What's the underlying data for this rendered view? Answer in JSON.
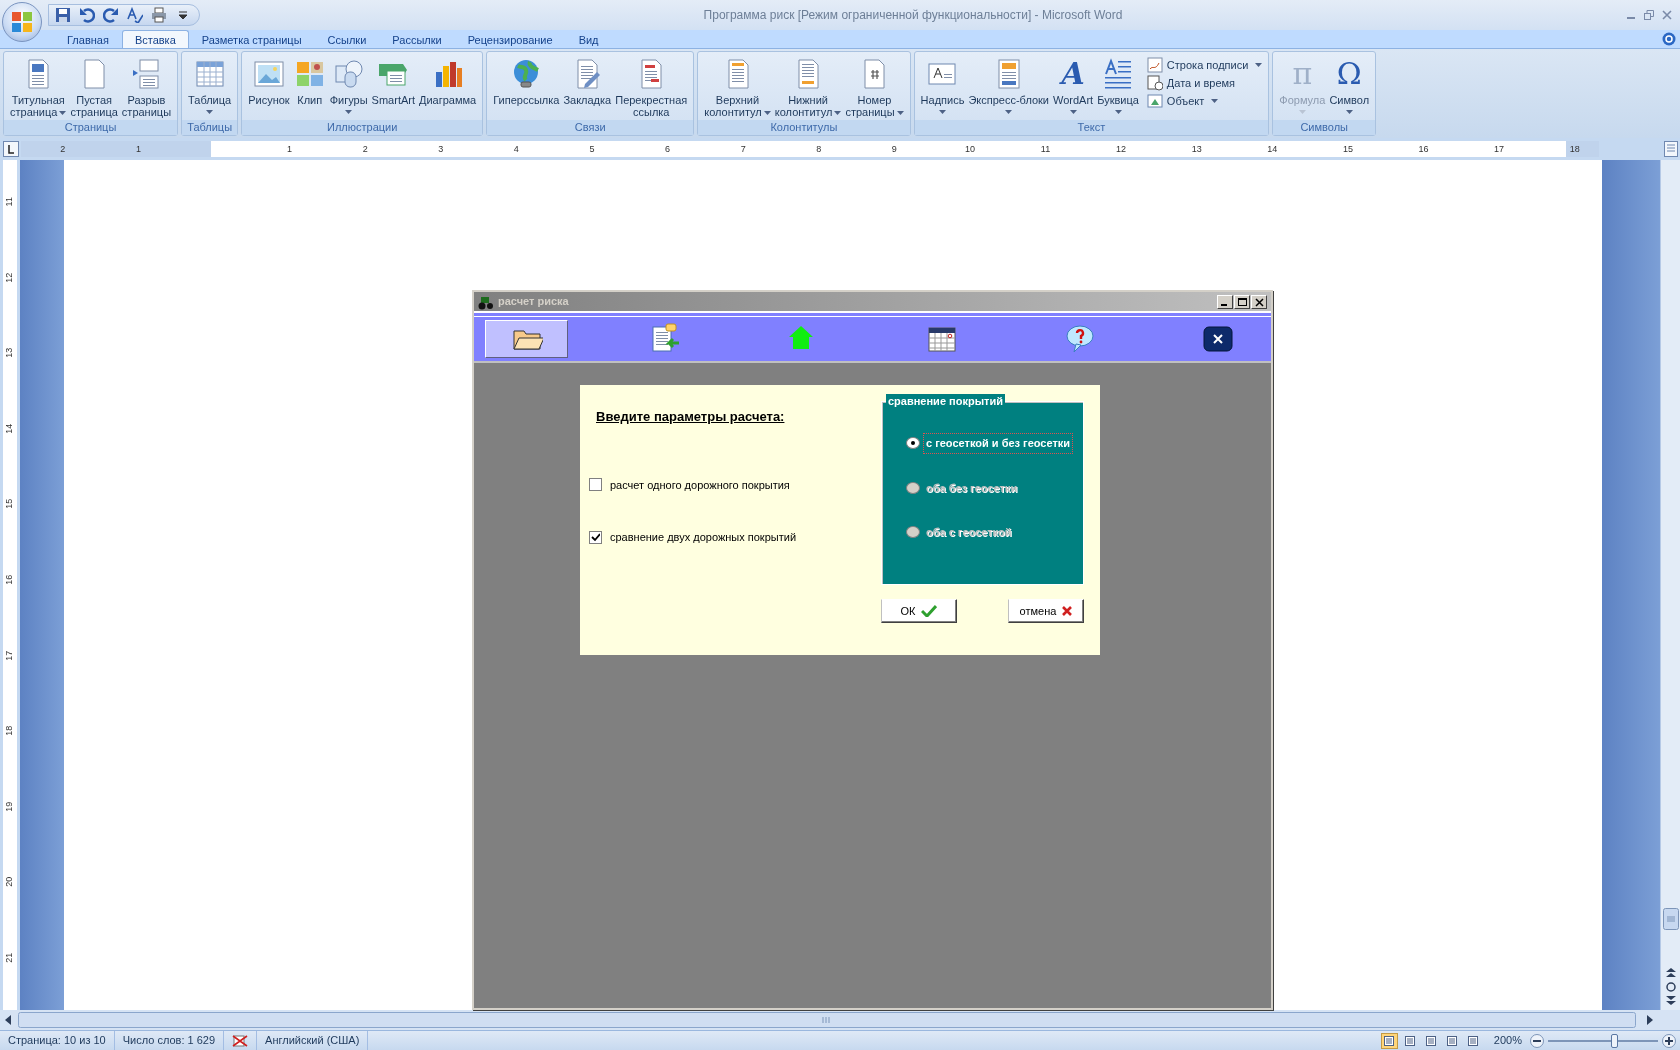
{
  "window": {
    "title": "Программа риск [Режим ограниченной функциональности] - Microsoft Word"
  },
  "tabs": [
    {
      "label": "Главная",
      "selected": false
    },
    {
      "label": "Вставка",
      "selected": true
    },
    {
      "label": "Разметка страницы",
      "selected": false
    },
    {
      "label": "Ссылки",
      "selected": false
    },
    {
      "label": "Рассылки",
      "selected": false
    },
    {
      "label": "Рецензирование",
      "selected": false
    },
    {
      "label": "Вид",
      "selected": false
    }
  ],
  "ribbon_groups": [
    {
      "label": "Страницы",
      "buttons": [
        {
          "lines": [
            "Титульная",
            "страница"
          ],
          "dropdown": true
        },
        {
          "lines": [
            "Пустая",
            "страница"
          ],
          "dropdown": false
        },
        {
          "lines": [
            "Разрыв",
            "страницы"
          ],
          "dropdown": false
        }
      ]
    },
    {
      "label": "Таблицы",
      "buttons": [
        {
          "lines": [
            "Таблица"
          ],
          "dropdown": true
        }
      ]
    },
    {
      "label": "Иллюстрации",
      "buttons": [
        {
          "lines": [
            "Рисунок"
          ],
          "dropdown": false
        },
        {
          "lines": [
            "Клип"
          ],
          "dropdown": false
        },
        {
          "lines": [
            "Фигуры"
          ],
          "dropdown": true
        },
        {
          "lines": [
            "SmartArt"
          ],
          "dropdown": false
        },
        {
          "lines": [
            "Диаграмма"
          ],
          "dropdown": false
        }
      ]
    },
    {
      "label": "Связи",
      "buttons": [
        {
          "lines": [
            "Гиперссылка"
          ],
          "dropdown": false
        },
        {
          "lines": [
            "Закладка"
          ],
          "dropdown": false
        },
        {
          "lines": [
            "Перекрестная",
            "ссылка"
          ],
          "dropdown": false
        }
      ]
    },
    {
      "label": "Колонтитулы",
      "buttons": [
        {
          "lines": [
            "Верхний",
            "колонтитул"
          ],
          "dropdown": true
        },
        {
          "lines": [
            "Нижний",
            "колонтитул"
          ],
          "dropdown": true
        },
        {
          "lines": [
            "Номер",
            "страницы"
          ],
          "dropdown": true
        }
      ]
    },
    {
      "label": "Текст",
      "buttons": [
        {
          "lines": [
            "Надпись"
          ],
          "dropdown": true
        },
        {
          "lines": [
            "Экспресс-блоки"
          ],
          "dropdown": true
        },
        {
          "lines": [
            "WordArt"
          ],
          "dropdown": true,
          "glyph": "A"
        },
        {
          "lines": [
            "Буквица"
          ],
          "dropdown": true
        }
      ],
      "small_buttons": [
        {
          "label": "Строка подписи",
          "dropdown": true
        },
        {
          "label": "Дата и время",
          "dropdown": false
        },
        {
          "label": "Объект",
          "dropdown": true
        }
      ]
    },
    {
      "label": "Символы",
      "buttons": [
        {
          "lines": [
            "Формула"
          ],
          "dropdown": true,
          "disabled": true,
          "glyph": "π"
        },
        {
          "lines": [
            "Символ"
          ],
          "dropdown": true,
          "disabled": false,
          "glyph": "Ω"
        }
      ]
    }
  ],
  "ruler": {
    "left_ticks": [
      "2",
      "1"
    ],
    "right_ticks": [
      "1",
      "2",
      "3",
      "4",
      "5",
      "6",
      "7",
      "8",
      "9",
      "10",
      "11",
      "12",
      "13",
      "14",
      "15",
      "16",
      "17",
      "18"
    ],
    "v_ticks": [
      "11",
      "12",
      "13",
      "14",
      "15",
      "16",
      "17",
      "18",
      "19",
      "20",
      "21"
    ]
  },
  "dialog": {
    "title": "расчет риска",
    "toolbar": [
      {
        "selected": true
      },
      {
        "selected": false
      },
      {
        "selected": false
      },
      {
        "selected": false
      },
      {
        "selected": false
      },
      {
        "selected": false
      }
    ],
    "heading": "Введите параметры расчета:",
    "checkboxes": [
      {
        "label": "расчет одного дорожного покрытия",
        "checked": false
      },
      {
        "label": "сравнение двух дорожных покрытий",
        "checked": true
      }
    ],
    "group": {
      "title": "сравнение покрытий",
      "options": [
        {
          "label": "с геосеткой и без геосетки",
          "selected": true,
          "disabled": false
        },
        {
          "label": "оба без геосетки",
          "selected": false,
          "disabled": true
        },
        {
          "label": "оба с геосеткой",
          "selected": false,
          "disabled": true
        }
      ]
    },
    "buttons": [
      {
        "label": "ОК",
        "kind": "ok"
      },
      {
        "label": "отмена",
        "kind": "cancel"
      }
    ]
  },
  "status_bar": {
    "items": [
      "Страница: 10 из 10",
      "Число слов: 1 629",
      "Английский (США)"
    ],
    "views": [
      {
        "selected": true
      },
      {
        "selected": false
      },
      {
        "selected": false
      },
      {
        "selected": false
      },
      {
        "selected": false
      }
    ],
    "zoom": "200%",
    "zoom_slider": {
      "level": 0.6
    }
  }
}
